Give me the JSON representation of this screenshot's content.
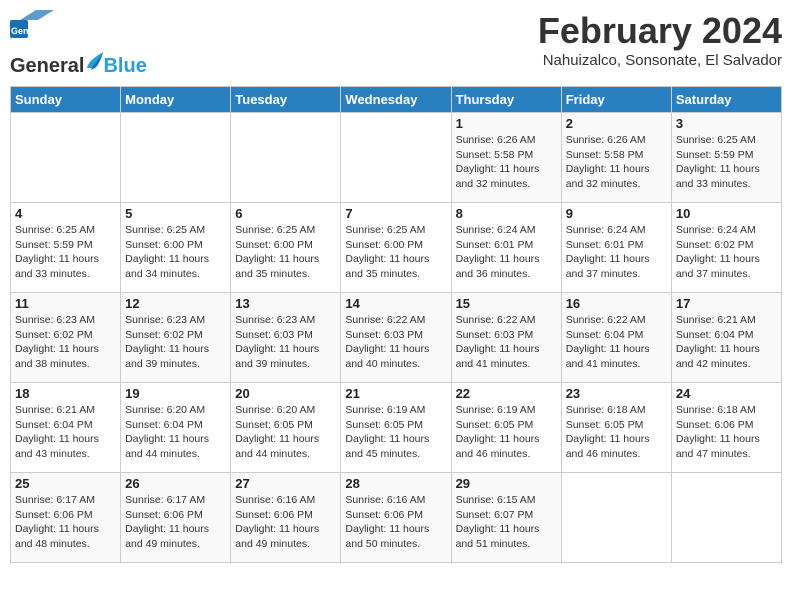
{
  "header": {
    "logo_general": "General",
    "logo_blue": "Blue",
    "title": "February 2024",
    "location": "Nahuizalco, Sonsonate, El Salvador"
  },
  "weekdays": [
    "Sunday",
    "Monday",
    "Tuesday",
    "Wednesday",
    "Thursday",
    "Friday",
    "Saturday"
  ],
  "weeks": [
    [
      {
        "day": "",
        "info": ""
      },
      {
        "day": "",
        "info": ""
      },
      {
        "day": "",
        "info": ""
      },
      {
        "day": "",
        "info": ""
      },
      {
        "day": "1",
        "info": "Sunrise: 6:26 AM\nSunset: 5:58 PM\nDaylight: 11 hours\nand 32 minutes."
      },
      {
        "day": "2",
        "info": "Sunrise: 6:26 AM\nSunset: 5:58 PM\nDaylight: 11 hours\nand 32 minutes."
      },
      {
        "day": "3",
        "info": "Sunrise: 6:25 AM\nSunset: 5:59 PM\nDaylight: 11 hours\nand 33 minutes."
      }
    ],
    [
      {
        "day": "4",
        "info": "Sunrise: 6:25 AM\nSunset: 5:59 PM\nDaylight: 11 hours\nand 33 minutes."
      },
      {
        "day": "5",
        "info": "Sunrise: 6:25 AM\nSunset: 6:00 PM\nDaylight: 11 hours\nand 34 minutes."
      },
      {
        "day": "6",
        "info": "Sunrise: 6:25 AM\nSunset: 6:00 PM\nDaylight: 11 hours\nand 35 minutes."
      },
      {
        "day": "7",
        "info": "Sunrise: 6:25 AM\nSunset: 6:00 PM\nDaylight: 11 hours\nand 35 minutes."
      },
      {
        "day": "8",
        "info": "Sunrise: 6:24 AM\nSunset: 6:01 PM\nDaylight: 11 hours\nand 36 minutes."
      },
      {
        "day": "9",
        "info": "Sunrise: 6:24 AM\nSunset: 6:01 PM\nDaylight: 11 hours\nand 37 minutes."
      },
      {
        "day": "10",
        "info": "Sunrise: 6:24 AM\nSunset: 6:02 PM\nDaylight: 11 hours\nand 37 minutes."
      }
    ],
    [
      {
        "day": "11",
        "info": "Sunrise: 6:23 AM\nSunset: 6:02 PM\nDaylight: 11 hours\nand 38 minutes."
      },
      {
        "day": "12",
        "info": "Sunrise: 6:23 AM\nSunset: 6:02 PM\nDaylight: 11 hours\nand 39 minutes."
      },
      {
        "day": "13",
        "info": "Sunrise: 6:23 AM\nSunset: 6:03 PM\nDaylight: 11 hours\nand 39 minutes."
      },
      {
        "day": "14",
        "info": "Sunrise: 6:22 AM\nSunset: 6:03 PM\nDaylight: 11 hours\nand 40 minutes."
      },
      {
        "day": "15",
        "info": "Sunrise: 6:22 AM\nSunset: 6:03 PM\nDaylight: 11 hours\nand 41 minutes."
      },
      {
        "day": "16",
        "info": "Sunrise: 6:22 AM\nSunset: 6:04 PM\nDaylight: 11 hours\nand 41 minutes."
      },
      {
        "day": "17",
        "info": "Sunrise: 6:21 AM\nSunset: 6:04 PM\nDaylight: 11 hours\nand 42 minutes."
      }
    ],
    [
      {
        "day": "18",
        "info": "Sunrise: 6:21 AM\nSunset: 6:04 PM\nDaylight: 11 hours\nand 43 minutes."
      },
      {
        "day": "19",
        "info": "Sunrise: 6:20 AM\nSunset: 6:04 PM\nDaylight: 11 hours\nand 44 minutes."
      },
      {
        "day": "20",
        "info": "Sunrise: 6:20 AM\nSunset: 6:05 PM\nDaylight: 11 hours\nand 44 minutes."
      },
      {
        "day": "21",
        "info": "Sunrise: 6:19 AM\nSunset: 6:05 PM\nDaylight: 11 hours\nand 45 minutes."
      },
      {
        "day": "22",
        "info": "Sunrise: 6:19 AM\nSunset: 6:05 PM\nDaylight: 11 hours\nand 46 minutes."
      },
      {
        "day": "23",
        "info": "Sunrise: 6:18 AM\nSunset: 6:05 PM\nDaylight: 11 hours\nand 46 minutes."
      },
      {
        "day": "24",
        "info": "Sunrise: 6:18 AM\nSunset: 6:06 PM\nDaylight: 11 hours\nand 47 minutes."
      }
    ],
    [
      {
        "day": "25",
        "info": "Sunrise: 6:17 AM\nSunset: 6:06 PM\nDaylight: 11 hours\nand 48 minutes."
      },
      {
        "day": "26",
        "info": "Sunrise: 6:17 AM\nSunset: 6:06 PM\nDaylight: 11 hours\nand 49 minutes."
      },
      {
        "day": "27",
        "info": "Sunrise: 6:16 AM\nSunset: 6:06 PM\nDaylight: 11 hours\nand 49 minutes."
      },
      {
        "day": "28",
        "info": "Sunrise: 6:16 AM\nSunset: 6:06 PM\nDaylight: 11 hours\nand 50 minutes."
      },
      {
        "day": "29",
        "info": "Sunrise: 6:15 AM\nSunset: 6:07 PM\nDaylight: 11 hours\nand 51 minutes."
      },
      {
        "day": "",
        "info": ""
      },
      {
        "day": "",
        "info": ""
      }
    ]
  ]
}
